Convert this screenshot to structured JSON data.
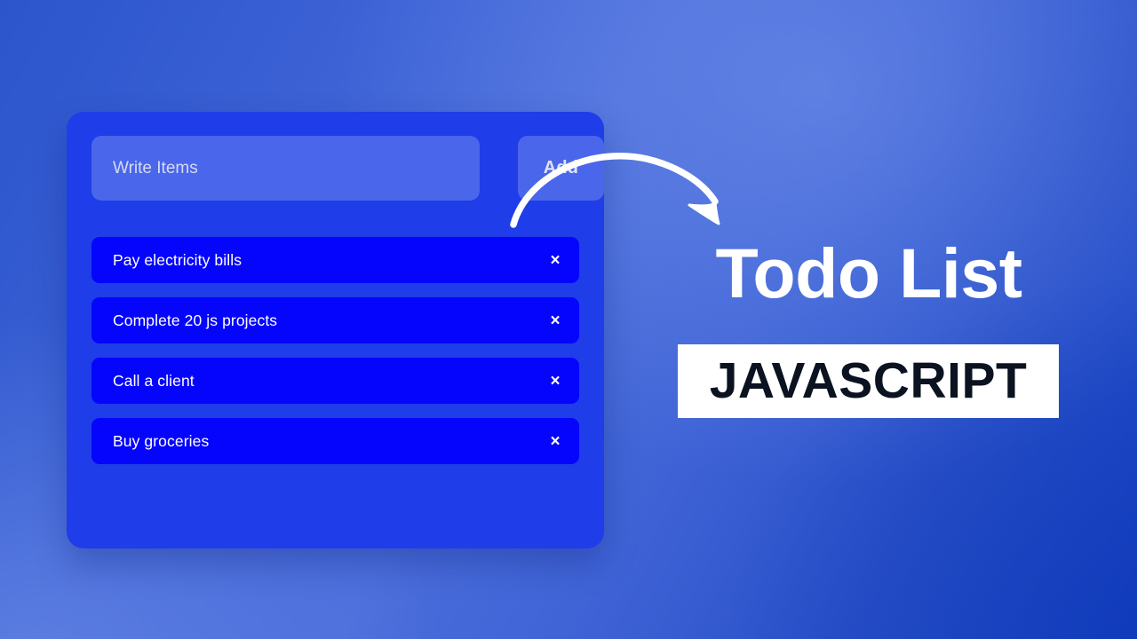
{
  "theme": {
    "page_bg_light": "#4a6ddb",
    "page_bg_dark": "#1744c6",
    "card_bg": "#1f3de8",
    "field_bg": "#4a66ea",
    "item_bg": "#0505fe",
    "accent_white": "#ffffff",
    "subtitle_text_color": "#0b1220"
  },
  "card": {
    "input": {
      "placeholder": "Write Items",
      "value": ""
    },
    "add_button_label": "Add",
    "items": [
      {
        "label": "Pay electricity bills",
        "delete_glyph": "×"
      },
      {
        "label": "Complete 20 js projects",
        "delete_glyph": "×"
      },
      {
        "label": "Call a client",
        "delete_glyph": "×"
      },
      {
        "label": "Buy groceries",
        "delete_glyph": "×"
      }
    ]
  },
  "headline": {
    "title": "Todo List",
    "subtitle": "JAVASCRIPT"
  },
  "decor": {
    "arrow_icon": "curved-arrow-icon"
  }
}
